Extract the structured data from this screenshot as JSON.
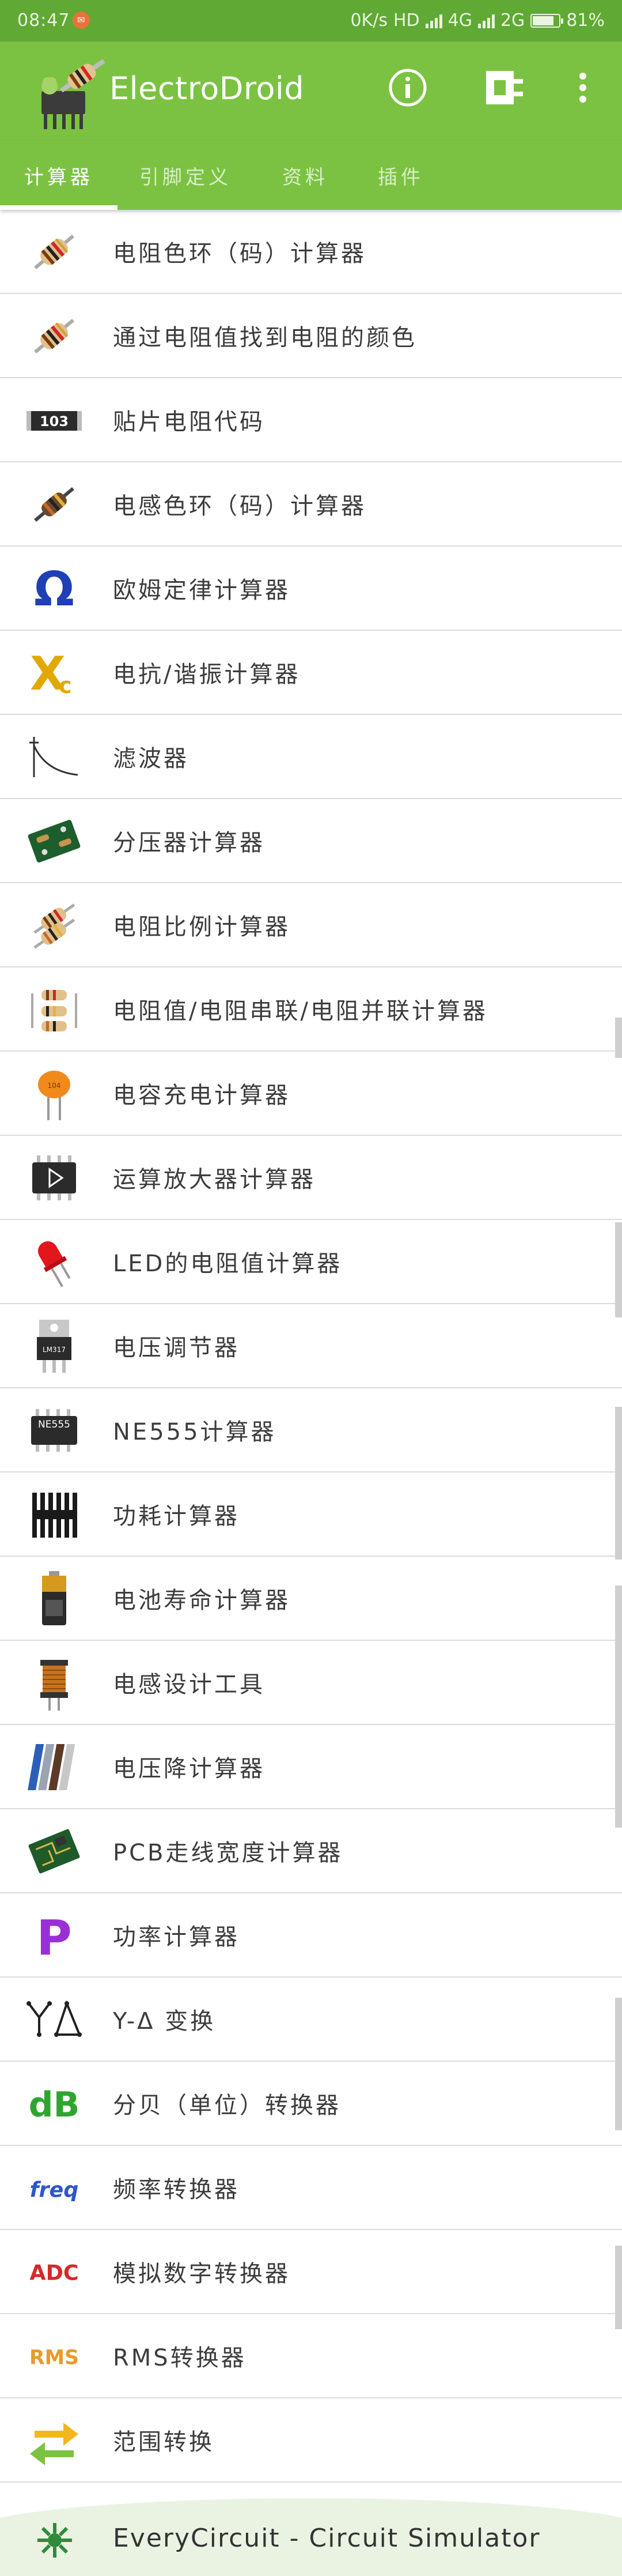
{
  "status_bar": {
    "time": "08:47",
    "net_speed": "0K/s",
    "hd": "HD",
    "net1": "4G",
    "net2": "2G",
    "battery": "81%",
    "battery_level": 0.81
  },
  "app_bar": {
    "title": "ElectroDroid",
    "actions": {
      "info_icon": "info-icon",
      "plugin_icon": "plugin-icon",
      "more_icon": "more-vert-icon"
    }
  },
  "tabs": [
    {
      "label": "计算器",
      "selected": true
    },
    {
      "label": "引脚定义",
      "selected": false
    },
    {
      "label": "资料",
      "selected": false
    },
    {
      "label": "插件",
      "selected": false
    }
  ],
  "items": [
    {
      "label": "电阻色环（码）计算器",
      "icon": "resistor-icon"
    },
    {
      "label": "通过电阻值找到电阻的颜色",
      "icon": "resistor-icon"
    },
    {
      "label": "贴片电阻代码",
      "icon": "smd-resistor-icon",
      "icon_text": "103"
    },
    {
      "label": "电感色环（码）计算器",
      "icon": "inductor-icon"
    },
    {
      "label": "欧姆定律计算器",
      "icon": "ohm-icon",
      "icon_text": "Ω"
    },
    {
      "label": "电抗/谐振计算器",
      "icon": "reactance-icon",
      "icon_text": "X"
    },
    {
      "label": "滤波器",
      "icon": "filter-curve-icon"
    },
    {
      "label": "分压器计算器",
      "icon": "voltage-divider-board-icon"
    },
    {
      "label": "电阻比例计算器",
      "icon": "resistor-pair-icon"
    },
    {
      "label": "电阻值/电阻串联/电阻并联计算器",
      "icon": "resistor-network-icon"
    },
    {
      "label": "电容充电计算器",
      "icon": "capacitor-icon"
    },
    {
      "label": "运算放大器计算器",
      "icon": "opamp-chip-icon"
    },
    {
      "label": "LED的电阻值计算器",
      "icon": "led-icon"
    },
    {
      "label": "电压调节器",
      "icon": "voltage-regulator-icon",
      "icon_text": "LM317"
    },
    {
      "label": "NE555计算器",
      "icon": "ne555-chip-icon",
      "icon_text": "NE555"
    },
    {
      "label": "功耗计算器",
      "icon": "heatsink-icon"
    },
    {
      "label": "电池寿命计算器",
      "icon": "battery-icon"
    },
    {
      "label": "电感设计工具",
      "icon": "coil-icon"
    },
    {
      "label": "电压降计算器",
      "icon": "wire-icon"
    },
    {
      "label": "PCB走线宽度计算器",
      "icon": "pcb-icon"
    },
    {
      "label": "功率计算器",
      "icon": "power-p-icon",
      "icon_text": "P"
    },
    {
      "label": "Y-Δ 变换",
      "icon": "y-delta-icon"
    },
    {
      "label": "分贝（单位）转换器",
      "icon": "db-icon",
      "icon_text": "dB"
    },
    {
      "label": "频率转换器",
      "icon": "freq-icon",
      "icon_text": "freq"
    },
    {
      "label": "模拟数字转换器",
      "icon": "adc-icon",
      "icon_text": "ADC"
    },
    {
      "label": "RMS转换器",
      "icon": "rms-icon",
      "icon_text": "RMS"
    },
    {
      "label": "范围转换",
      "icon": "swap-arrows-icon"
    }
  ],
  "footer": {
    "label": "EveryCircuit - Circuit Simulator",
    "icon": "everycircuit-icon"
  },
  "colors": {
    "status_bar": "#5fa934",
    "app_bar": "#7cc242",
    "footer_bg": "#eaf3e2"
  }
}
